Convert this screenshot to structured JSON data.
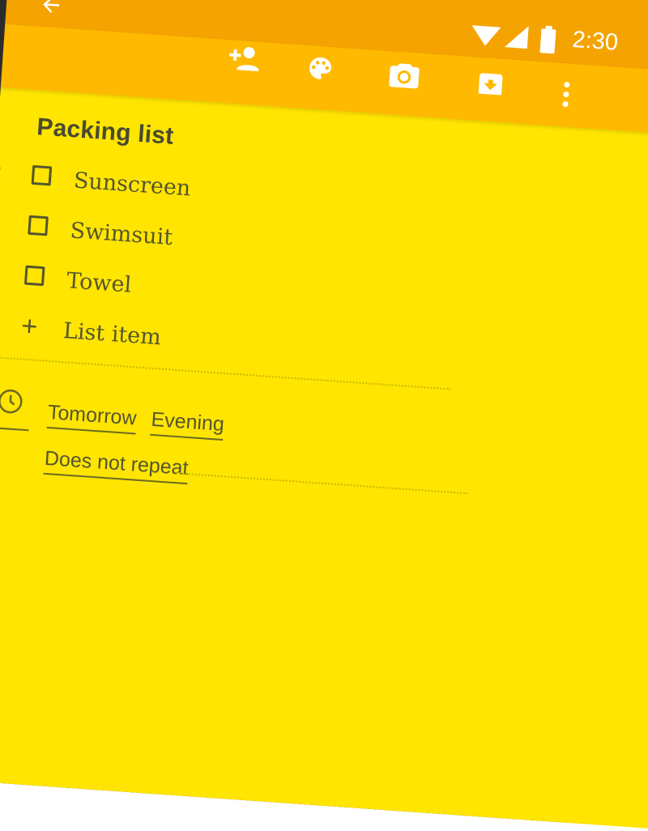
{
  "status_bar": {
    "time": "2:30",
    "icons": [
      "wifi-icon",
      "signal-icon",
      "battery-icon"
    ]
  },
  "toolbar": {
    "icons": [
      "back-arrow-icon",
      "add-collaborator-icon",
      "palette-icon",
      "camera-icon",
      "archive-icon",
      "more-vert-icon"
    ]
  },
  "note": {
    "title": "Packing list",
    "items": [
      {
        "label": "Sunscreen",
        "checked": false
      },
      {
        "label": "Swimsuit",
        "checked": false
      },
      {
        "label": "Towel",
        "checked": false
      }
    ],
    "add_item_placeholder": "List item"
  },
  "reminder": {
    "date": "Tomorrow",
    "time": "Evening",
    "repeat": "Does not repeat"
  },
  "colors": {
    "note_background": "#ffe500",
    "toolbar": "#ffb900",
    "status_bar": "#f5a300",
    "text": "#55552e"
  }
}
